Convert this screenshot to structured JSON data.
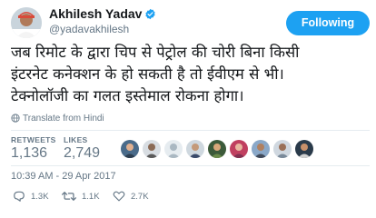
{
  "author": {
    "name": "Akhilesh Yadav",
    "handle": "@yadavakhilesh"
  },
  "follow": {
    "label": "Following"
  },
  "tweet": {
    "lines": [
      "जब रिमोट के द्वारा चिप से पेट्रोल की चोरी बिना किसी",
      "इंटरनेट कनेक्शन के हो सकती है तो ईवीएम से भी।",
      "टेक्नोलॉजी का गलत इस्तेमाल रोकना होगा।"
    ]
  },
  "translate": {
    "label": "Translate from Hindi"
  },
  "stats": {
    "retweets_label": "RETWEETS",
    "retweets_value": "1,136",
    "likes_label": "LIKES",
    "likes_value": "2,749"
  },
  "likers": {
    "count": 9
  },
  "timestamp": "10:39 AM - 29 Apr 2017",
  "actions": {
    "replies": "1.3K",
    "retweets": "1.1K",
    "likes": "2.7K"
  },
  "colors": {
    "accent": "#1da1f2",
    "muted": "#657786",
    "text": "#14171a",
    "divider": "#e6ecf0"
  },
  "icons": [
    "verified-badge-icon",
    "globe-icon",
    "reply-icon",
    "retweet-icon",
    "heart-icon"
  ]
}
